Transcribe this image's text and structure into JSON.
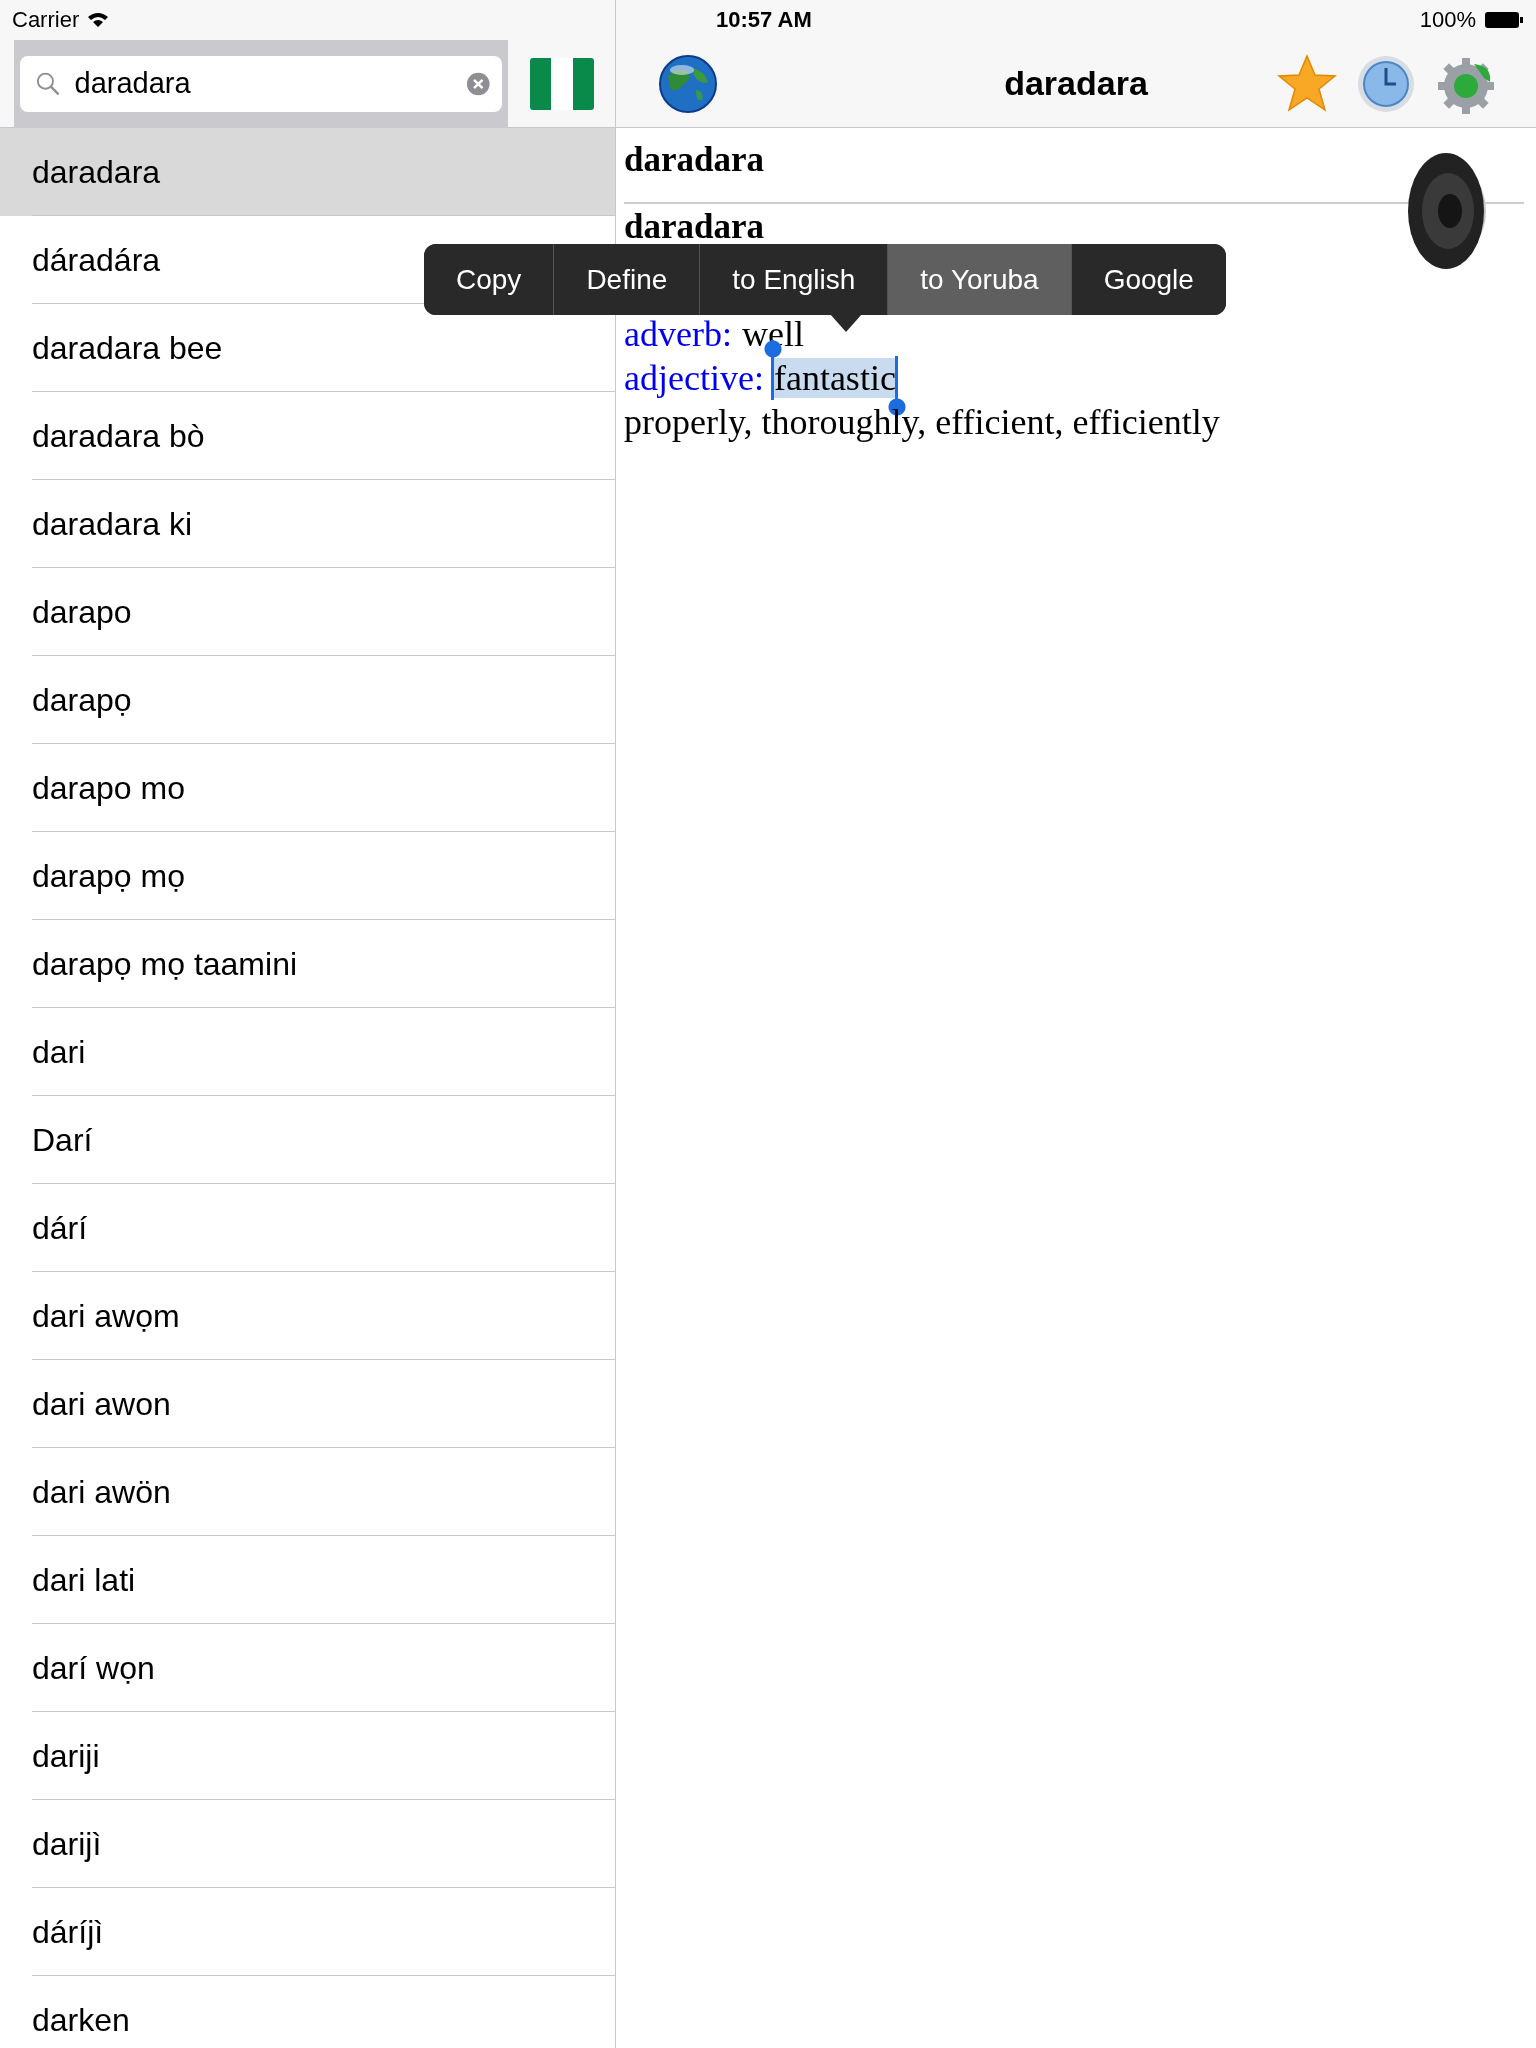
{
  "status_bar": {
    "carrier": "Carrier",
    "time": "10:57 AM",
    "battery": "100%"
  },
  "search": {
    "value": "daradara"
  },
  "words": [
    {
      "label": "daradara",
      "selected": true
    },
    {
      "label": "dáradára",
      "selected": false
    },
    {
      "label": "daradara bee",
      "selected": false
    },
    {
      "label": "daradara bò",
      "selected": false
    },
    {
      "label": "daradara ki",
      "selected": false
    },
    {
      "label": "darapo",
      "selected": false
    },
    {
      "label": "darapọ",
      "selected": false
    },
    {
      "label": "darapo mo",
      "selected": false
    },
    {
      "label": "darapọ mọ",
      "selected": false
    },
    {
      "label": "darapọ mọ taamini",
      "selected": false
    },
    {
      "label": "dari",
      "selected": false
    },
    {
      "label": "Darí",
      "selected": false
    },
    {
      "label": "dárí",
      "selected": false
    },
    {
      "label": "dari awọm",
      "selected": false
    },
    {
      "label": "dari awon",
      "selected": false
    },
    {
      "label": "dari awön",
      "selected": false
    },
    {
      "label": "dari lati",
      "selected": false
    },
    {
      "label": "darí wọn",
      "selected": false
    },
    {
      "label": "dariji",
      "selected": false
    },
    {
      "label": "darijì",
      "selected": false
    },
    {
      "label": "dáríjì",
      "selected": false
    },
    {
      "label": "darken",
      "selected": false
    }
  ],
  "nav": {
    "title": "daradara"
  },
  "entry": {
    "headword": "daradara",
    "subheading": "daradara",
    "definitions": [
      {
        "label": "adverb:",
        "text": "well",
        "highlighted": false
      },
      {
        "label": "adjective:",
        "text": "fantastic",
        "highlighted": true
      },
      {
        "text": "properly, thoroughly, efficient, efficiently",
        "highlighted": false
      }
    ]
  },
  "context_menu": [
    {
      "label": "Copy",
      "selected": false
    },
    {
      "label": "Define",
      "selected": false
    },
    {
      "label": "to English",
      "selected": false
    },
    {
      "label": "to Yoruba",
      "selected": true
    },
    {
      "label": "Google",
      "selected": false
    }
  ]
}
